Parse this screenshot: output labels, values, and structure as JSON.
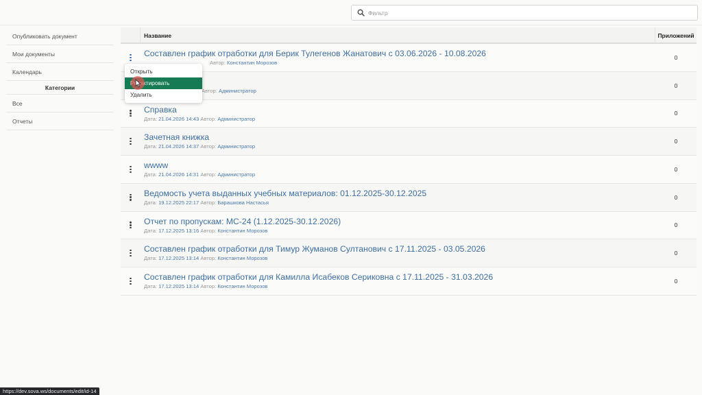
{
  "search": {
    "placeholder": "Фильтр",
    "value": ""
  },
  "sidebar": {
    "items": [
      {
        "label": "Опубликовать документ"
      },
      {
        "label": "Мои документы"
      },
      {
        "label": "Календарь"
      }
    ],
    "categories_header": "Категории",
    "categories": [
      {
        "label": "Все"
      },
      {
        "label": "Отчеты"
      }
    ]
  },
  "table": {
    "headers": {
      "name": "Название",
      "attachments": "Приложений"
    },
    "meta_labels": {
      "date": "Дата:",
      "author": "Автор:"
    },
    "rows": [
      {
        "title": "Составлен график отработки для Берик Тулегенов Жанатович с 03.06.2026 - 10.08.2026",
        "date": "",
        "author": "Константин Морозов",
        "attachments": "0"
      },
      {
        "title": "",
        "date": "",
        "author": "Администратор",
        "attachments": "0"
      },
      {
        "title": "Справка",
        "date": "21.04.2026 14:43",
        "author": "Администратор",
        "attachments": "0"
      },
      {
        "title": "Зачетная книжка",
        "date": "21.04.2026 14:37",
        "author": "Администратор",
        "attachments": "0"
      },
      {
        "title": "wwww",
        "date": "21.04.2026 14:31",
        "author": "Администратор",
        "attachments": "0"
      },
      {
        "title": "Ведомость учета выданных учебных материалов: 01.12.2025-30.12.2025",
        "date": "19.12.2025 22:17",
        "author": "Барашкова Настасья",
        "attachments": "0"
      },
      {
        "title": "Отчет по пропускам: МС-24 (1.12.2025-30.12.2026)",
        "date": "17.12.2025 13:16",
        "author": "Константин Морозов",
        "attachments": "0"
      },
      {
        "title": "Составлен график отработки для Тимур Жуманов Султанович с 17.11.2025 - 03.05.2026",
        "date": "17.12.2025 13:14",
        "author": "Константин Морозов",
        "attachments": "0"
      },
      {
        "title": "Составлен график отработки для Камилла Исабеков Сериковна с 17.11.2025 - 31.03.2026",
        "date": "17.12.2025 13:14",
        "author": "Константин Морозов",
        "attachments": "0"
      }
    ]
  },
  "context_menu": {
    "items": [
      {
        "label": "Открыть"
      },
      {
        "label": "Редактировать"
      },
      {
        "label": "Удалить"
      }
    ]
  },
  "status_bar": {
    "url": "https://dev.sova.ws/documents/edit/id-14"
  },
  "colors": {
    "accent": "#167a55",
    "link": "#3d6fa6",
    "cursor": "#e55353"
  }
}
